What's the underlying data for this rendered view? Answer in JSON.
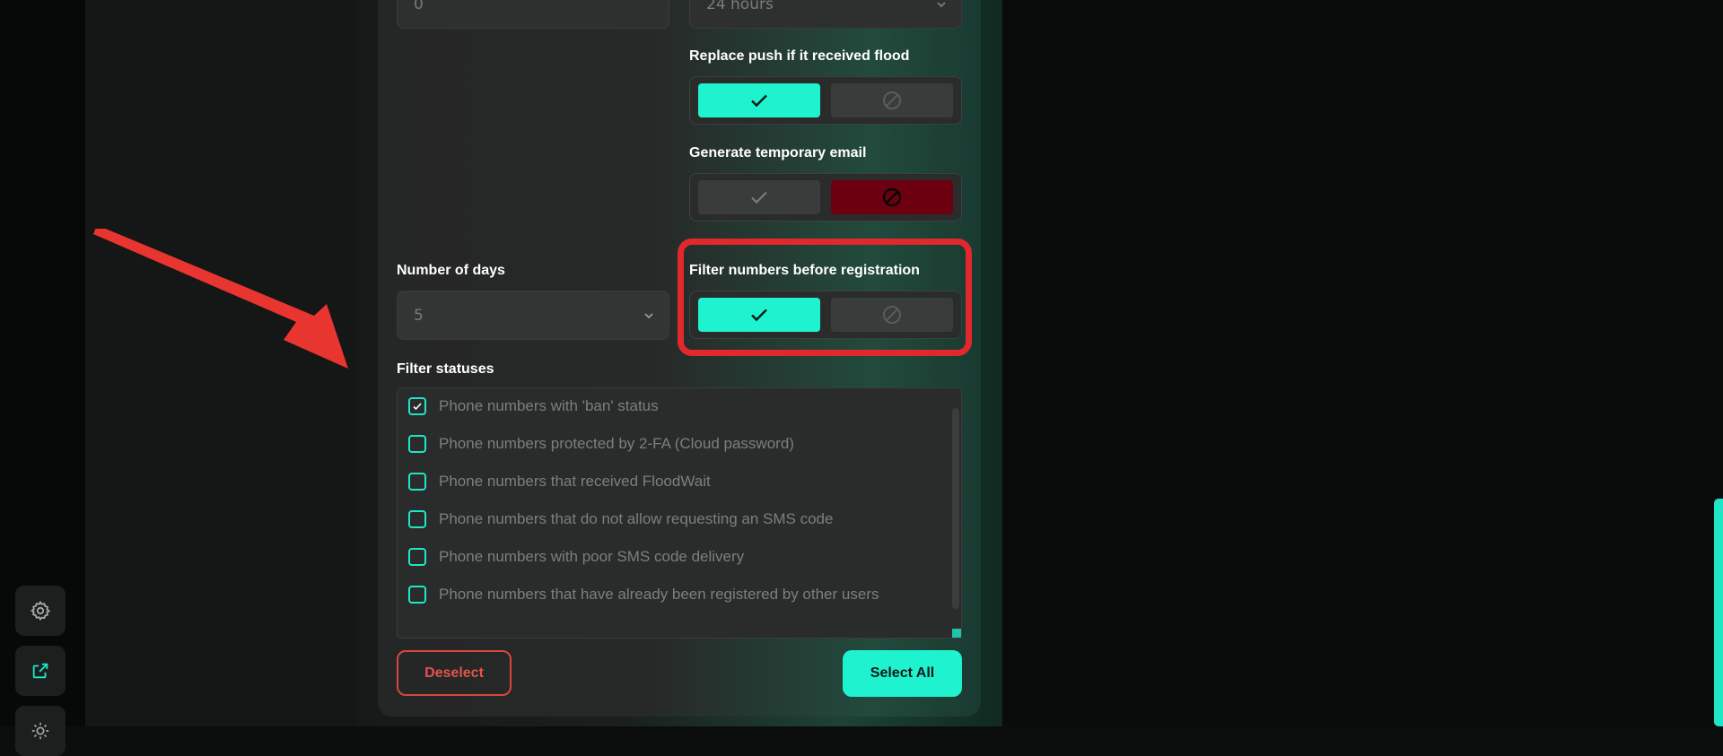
{
  "hours_field": {
    "value": "0"
  },
  "duration_select": {
    "value": "24 hours"
  },
  "replace_push": {
    "label": "Replace push if it received flood",
    "state": "enabled"
  },
  "temp_email": {
    "label": "Generate temporary email",
    "state": "disabled"
  },
  "days": {
    "label": "Number of days",
    "value": "5"
  },
  "filter_before_reg": {
    "label": "Filter numbers before registration",
    "state": "enabled"
  },
  "filter_statuses": {
    "label": "Filter statuses",
    "items": [
      {
        "text": "Phone numbers with 'ban' status",
        "checked": true
      },
      {
        "text": "Phone numbers protected by 2-FA (Cloud password)",
        "checked": false
      },
      {
        "text": "Phone numbers that received FloodWait",
        "checked": false
      },
      {
        "text": "Phone numbers that do not allow requesting an SMS code",
        "checked": false
      },
      {
        "text": "Phone numbers with poor SMS code delivery",
        "checked": false
      },
      {
        "text": "Phone numbers that have already been registered by other users",
        "checked": false
      }
    ]
  },
  "actions": {
    "deselect": "Deselect",
    "select_all": "Select All"
  },
  "colors": {
    "accent": "#1ff2cf",
    "danger": "#e0282d",
    "disabled_red": "#6d0010"
  },
  "icons": {
    "settings": "gear-icon",
    "external": "external-link-icon",
    "theme": "sun-icon"
  }
}
